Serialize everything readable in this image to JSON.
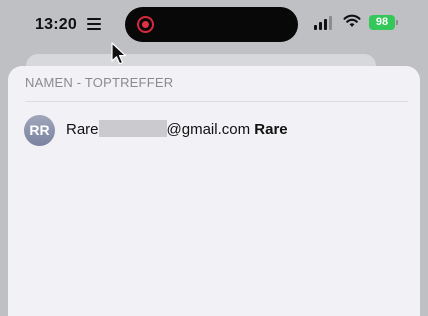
{
  "status_bar": {
    "time": "13:20",
    "battery_percent": "98",
    "focus_icon": "list-icon",
    "recording_icon": "screen-record-icon",
    "signal_icon": "cellular-signal-icon",
    "wifi_icon": "wifi-icon"
  },
  "section": {
    "header": "NAMEN - TOPTREFFER"
  },
  "result": {
    "avatar_initials": "RR",
    "email_prefix": "Rare",
    "email_suffix": "@gmail.com",
    "name": "Rare"
  },
  "colors": {
    "background": "#bfc0c4",
    "sheet": "#f2f2f6",
    "battery": "#34c759",
    "record": "#d8283a",
    "avatar": "#8b92ad"
  }
}
